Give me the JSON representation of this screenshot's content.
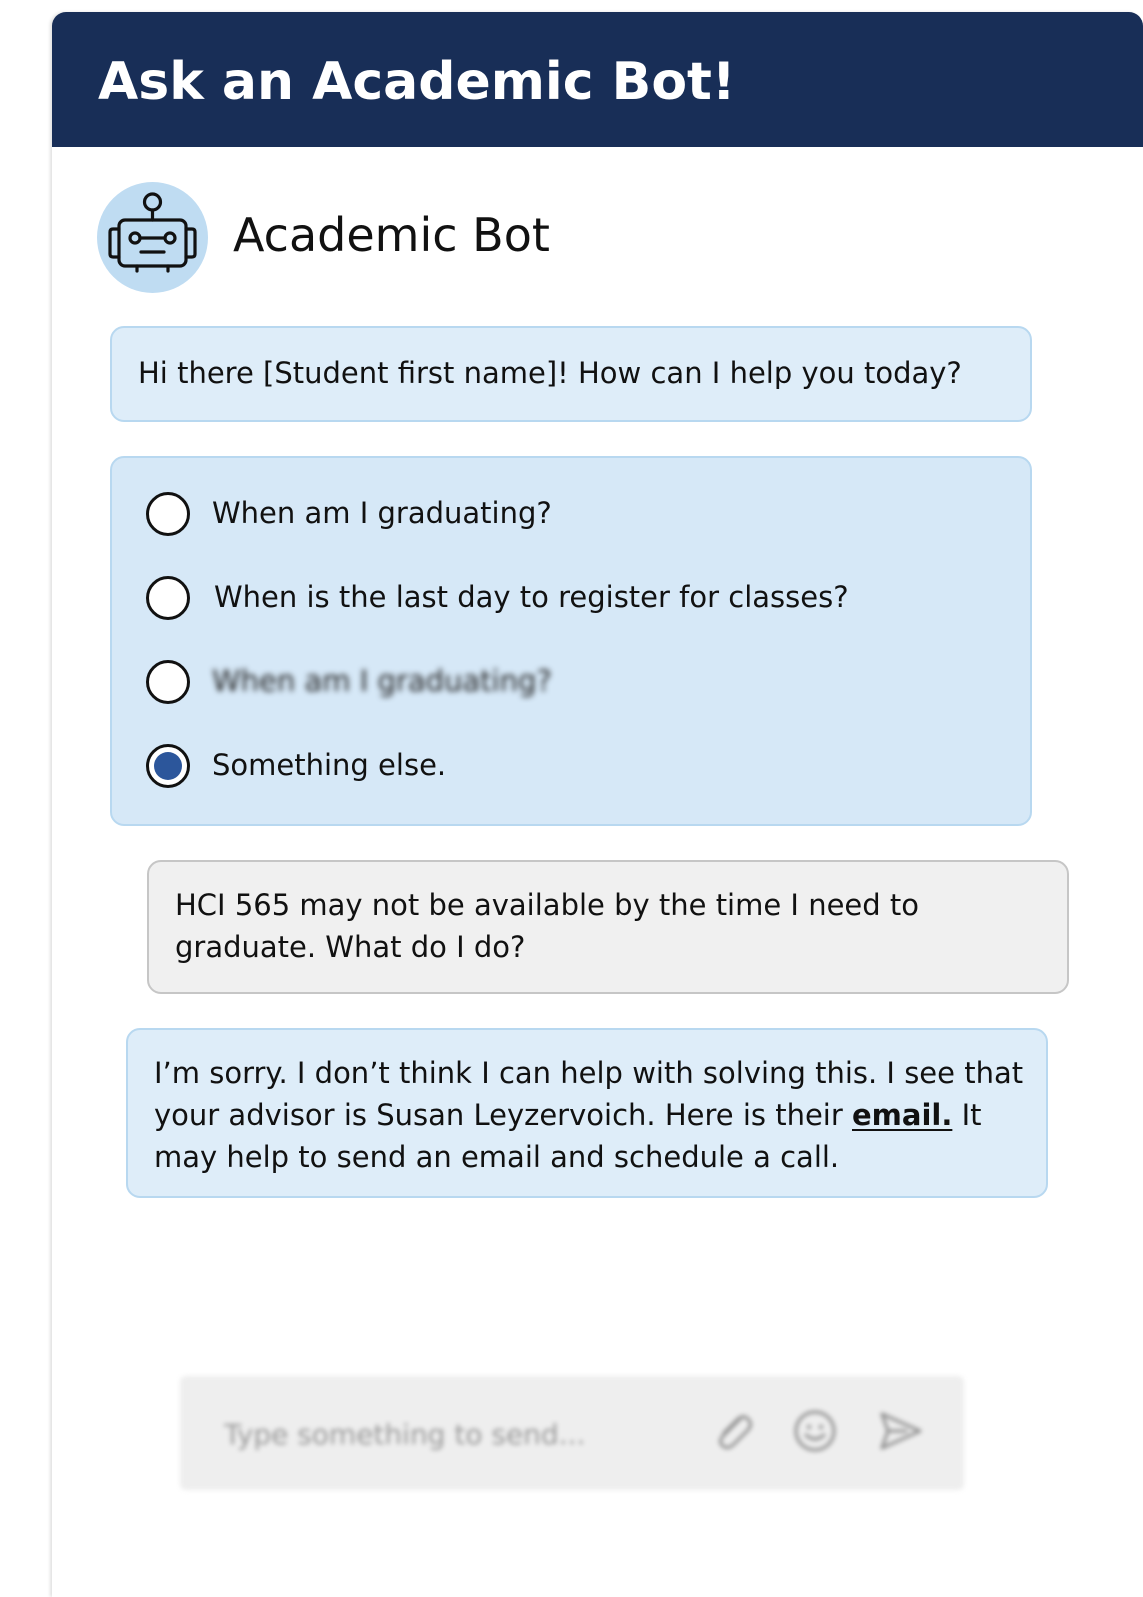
{
  "header": {
    "title": "Ask an Academic Bot!"
  },
  "bot": {
    "name": "Academic Bot",
    "avatar_icon": "robot-icon"
  },
  "messages": {
    "greeting": "Hi there [Student first name]! How can I help you today?",
    "options": [
      {
        "label": "When am I graduating?",
        "selected": false,
        "blurred": false
      },
      {
        "label": "When is the last day to register for classes?",
        "selected": false,
        "blurred": false
      },
      {
        "label": "When am I graduating?",
        "selected": false,
        "blurred": true
      },
      {
        "label": "Something else.",
        "selected": true,
        "blurred": false
      }
    ],
    "user_message": "HCI 565 may not be available by the time I need to graduate. What do I do?",
    "reply": {
      "before_link": "I’m sorry. I don’t think I can help with solving this. I see that your advisor is Susan Leyzervoich. Here is their ",
      "link_text": "email.",
      "after_link": " It may help to send an email and schedule a call."
    }
  },
  "composer": {
    "placeholder": "Type something to send...",
    "icons": [
      "paperclip-icon",
      "smiley-icon",
      "send-icon"
    ]
  },
  "colors": {
    "header_bg": "#182e57",
    "bot_bubble_bg": "#deedf9",
    "options_bg": "#d6e8f7",
    "bubble_border": "#b8d8f0",
    "user_bubble_bg": "#f0f0f0",
    "radio_selected": "#2c569b",
    "avatar_bg": "#bfdcf2"
  }
}
